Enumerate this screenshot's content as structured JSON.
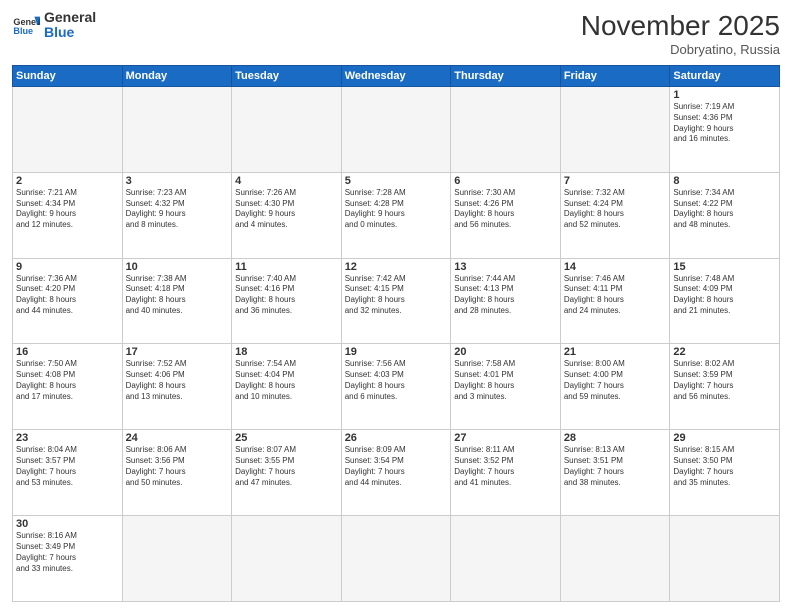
{
  "header": {
    "logo_general": "General",
    "logo_blue": "Blue",
    "month_title": "November 2025",
    "subtitle": "Dobryatino, Russia"
  },
  "days_of_week": [
    "Sunday",
    "Monday",
    "Tuesday",
    "Wednesday",
    "Thursday",
    "Friday",
    "Saturday"
  ],
  "weeks": [
    [
      {
        "day": "",
        "info": ""
      },
      {
        "day": "",
        "info": ""
      },
      {
        "day": "",
        "info": ""
      },
      {
        "day": "",
        "info": ""
      },
      {
        "day": "",
        "info": ""
      },
      {
        "day": "",
        "info": ""
      },
      {
        "day": "1",
        "info": "Sunrise: 7:19 AM\nSunset: 4:36 PM\nDaylight: 9 hours\nand 16 minutes."
      }
    ],
    [
      {
        "day": "2",
        "info": "Sunrise: 7:21 AM\nSunset: 4:34 PM\nDaylight: 9 hours\nand 12 minutes."
      },
      {
        "day": "3",
        "info": "Sunrise: 7:23 AM\nSunset: 4:32 PM\nDaylight: 9 hours\nand 8 minutes."
      },
      {
        "day": "4",
        "info": "Sunrise: 7:26 AM\nSunset: 4:30 PM\nDaylight: 9 hours\nand 4 minutes."
      },
      {
        "day": "5",
        "info": "Sunrise: 7:28 AM\nSunset: 4:28 PM\nDaylight: 9 hours\nand 0 minutes."
      },
      {
        "day": "6",
        "info": "Sunrise: 7:30 AM\nSunset: 4:26 PM\nDaylight: 8 hours\nand 56 minutes."
      },
      {
        "day": "7",
        "info": "Sunrise: 7:32 AM\nSunset: 4:24 PM\nDaylight: 8 hours\nand 52 minutes."
      },
      {
        "day": "8",
        "info": "Sunrise: 7:34 AM\nSunset: 4:22 PM\nDaylight: 8 hours\nand 48 minutes."
      }
    ],
    [
      {
        "day": "9",
        "info": "Sunrise: 7:36 AM\nSunset: 4:20 PM\nDaylight: 8 hours\nand 44 minutes."
      },
      {
        "day": "10",
        "info": "Sunrise: 7:38 AM\nSunset: 4:18 PM\nDaylight: 8 hours\nand 40 minutes."
      },
      {
        "day": "11",
        "info": "Sunrise: 7:40 AM\nSunset: 4:16 PM\nDaylight: 8 hours\nand 36 minutes."
      },
      {
        "day": "12",
        "info": "Sunrise: 7:42 AM\nSunset: 4:15 PM\nDaylight: 8 hours\nand 32 minutes."
      },
      {
        "day": "13",
        "info": "Sunrise: 7:44 AM\nSunset: 4:13 PM\nDaylight: 8 hours\nand 28 minutes."
      },
      {
        "day": "14",
        "info": "Sunrise: 7:46 AM\nSunset: 4:11 PM\nDaylight: 8 hours\nand 24 minutes."
      },
      {
        "day": "15",
        "info": "Sunrise: 7:48 AM\nSunset: 4:09 PM\nDaylight: 8 hours\nand 21 minutes."
      }
    ],
    [
      {
        "day": "16",
        "info": "Sunrise: 7:50 AM\nSunset: 4:08 PM\nDaylight: 8 hours\nand 17 minutes."
      },
      {
        "day": "17",
        "info": "Sunrise: 7:52 AM\nSunset: 4:06 PM\nDaylight: 8 hours\nand 13 minutes."
      },
      {
        "day": "18",
        "info": "Sunrise: 7:54 AM\nSunset: 4:04 PM\nDaylight: 8 hours\nand 10 minutes."
      },
      {
        "day": "19",
        "info": "Sunrise: 7:56 AM\nSunset: 4:03 PM\nDaylight: 8 hours\nand 6 minutes."
      },
      {
        "day": "20",
        "info": "Sunrise: 7:58 AM\nSunset: 4:01 PM\nDaylight: 8 hours\nand 3 minutes."
      },
      {
        "day": "21",
        "info": "Sunrise: 8:00 AM\nSunset: 4:00 PM\nDaylight: 7 hours\nand 59 minutes."
      },
      {
        "day": "22",
        "info": "Sunrise: 8:02 AM\nSunset: 3:59 PM\nDaylight: 7 hours\nand 56 minutes."
      }
    ],
    [
      {
        "day": "23",
        "info": "Sunrise: 8:04 AM\nSunset: 3:57 PM\nDaylight: 7 hours\nand 53 minutes."
      },
      {
        "day": "24",
        "info": "Sunrise: 8:06 AM\nSunset: 3:56 PM\nDaylight: 7 hours\nand 50 minutes."
      },
      {
        "day": "25",
        "info": "Sunrise: 8:07 AM\nSunset: 3:55 PM\nDaylight: 7 hours\nand 47 minutes."
      },
      {
        "day": "26",
        "info": "Sunrise: 8:09 AM\nSunset: 3:54 PM\nDaylight: 7 hours\nand 44 minutes."
      },
      {
        "day": "27",
        "info": "Sunrise: 8:11 AM\nSunset: 3:52 PM\nDaylight: 7 hours\nand 41 minutes."
      },
      {
        "day": "28",
        "info": "Sunrise: 8:13 AM\nSunset: 3:51 PM\nDaylight: 7 hours\nand 38 minutes."
      },
      {
        "day": "29",
        "info": "Sunrise: 8:15 AM\nSunset: 3:50 PM\nDaylight: 7 hours\nand 35 minutes."
      }
    ],
    [
      {
        "day": "30",
        "info": "Sunrise: 8:16 AM\nSunset: 3:49 PM\nDaylight: 7 hours\nand 33 minutes."
      },
      {
        "day": "",
        "info": ""
      },
      {
        "day": "",
        "info": ""
      },
      {
        "day": "",
        "info": ""
      },
      {
        "day": "",
        "info": ""
      },
      {
        "day": "",
        "info": ""
      },
      {
        "day": "",
        "info": ""
      }
    ]
  ]
}
